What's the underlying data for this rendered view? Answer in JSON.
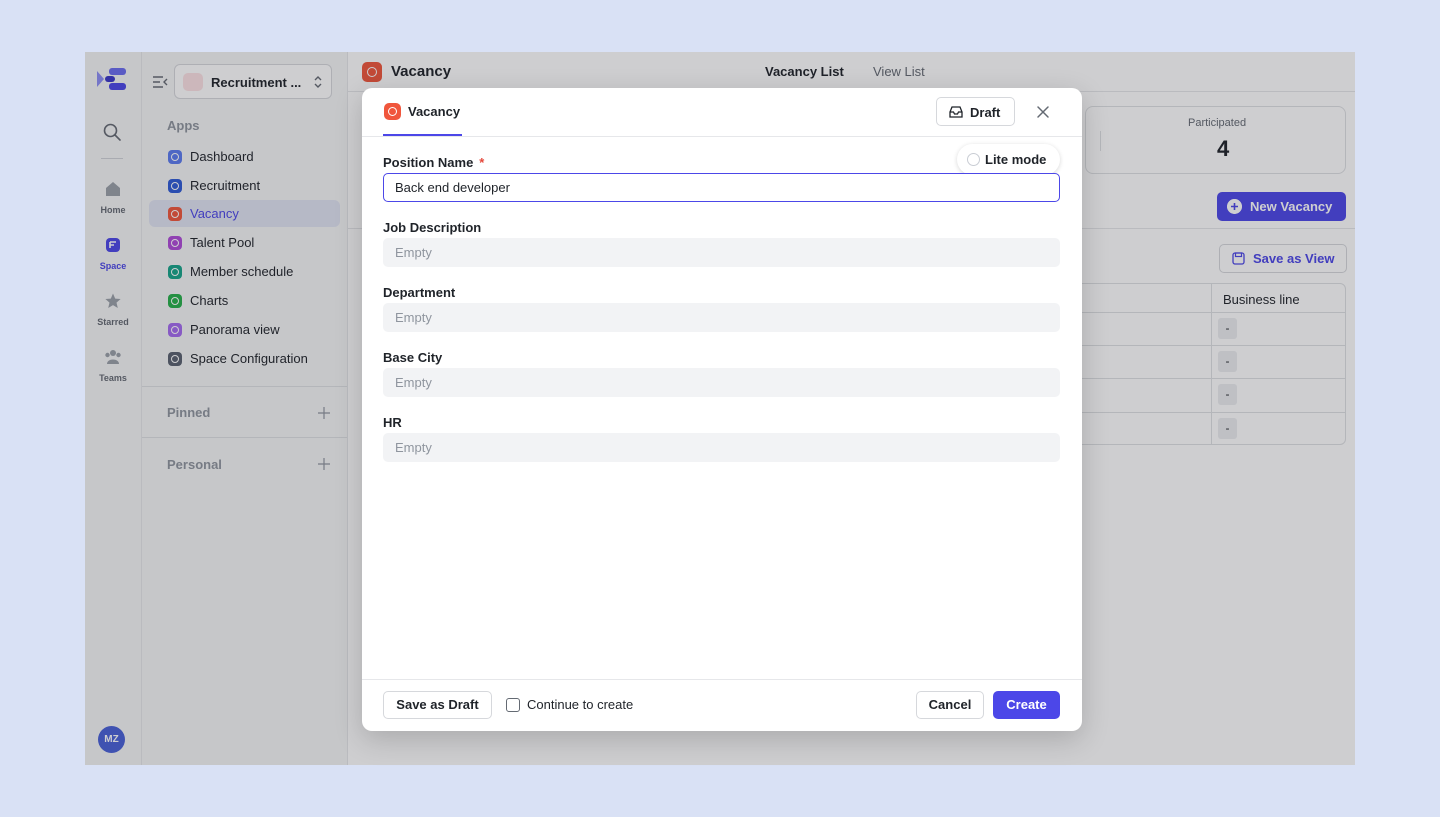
{
  "colors": {
    "accent": "#4c47e8",
    "vacancy": "#f0563c",
    "required": "#e5483b"
  },
  "rail": {
    "items": [
      {
        "label": "Home",
        "icon": "home-icon"
      },
      {
        "label": "Space",
        "icon": "space-icon"
      },
      {
        "label": "Starred",
        "icon": "star-icon"
      },
      {
        "label": "Teams",
        "icon": "teams-icon"
      }
    ],
    "avatar": "MZ"
  },
  "sidebar": {
    "space_name": "Recruitment ...",
    "apps_title": "Apps",
    "items": [
      {
        "label": "Dashboard",
        "color": "#5b7cf0"
      },
      {
        "label": "Recruitment",
        "color": "#2f5bd6"
      },
      {
        "label": "Vacancy",
        "color": "#f0563c"
      },
      {
        "label": "Talent Pool",
        "color": "#b04bd9"
      },
      {
        "label": "Member schedule",
        "color": "#17a58a"
      },
      {
        "label": "Charts",
        "color": "#26b04a"
      },
      {
        "label": "Panorama view",
        "color": "#a56bf0"
      },
      {
        "label": "Space Configuration",
        "color": "#5a6270"
      }
    ],
    "pinned": "Pinned",
    "personal": "Personal"
  },
  "main": {
    "title": "Vacancy",
    "tabs": [
      "Vacancy List",
      "View List"
    ],
    "stat": {
      "label": "Participated",
      "value": "4"
    },
    "new_vacancy": "New Vacancy",
    "save_view": "Save as View",
    "table": {
      "header": "Business line",
      "cells": [
        "-",
        "-",
        "-",
        "-"
      ]
    }
  },
  "modal": {
    "tab": "Vacancy",
    "draft": "Draft",
    "lite_mode": "Lite mode",
    "fields": [
      {
        "label": "Position Name",
        "required": "*",
        "value": "Back end developer"
      },
      {
        "label": "Job Description",
        "placeholder": "Empty"
      },
      {
        "label": "Department",
        "placeholder": "Empty"
      },
      {
        "label": "Base City",
        "placeholder": "Empty"
      },
      {
        "label": "HR",
        "placeholder": "Empty"
      }
    ],
    "footer": {
      "save_draft": "Save as Draft",
      "continue": "Continue to create",
      "cancel": "Cancel",
      "create": "Create"
    }
  }
}
